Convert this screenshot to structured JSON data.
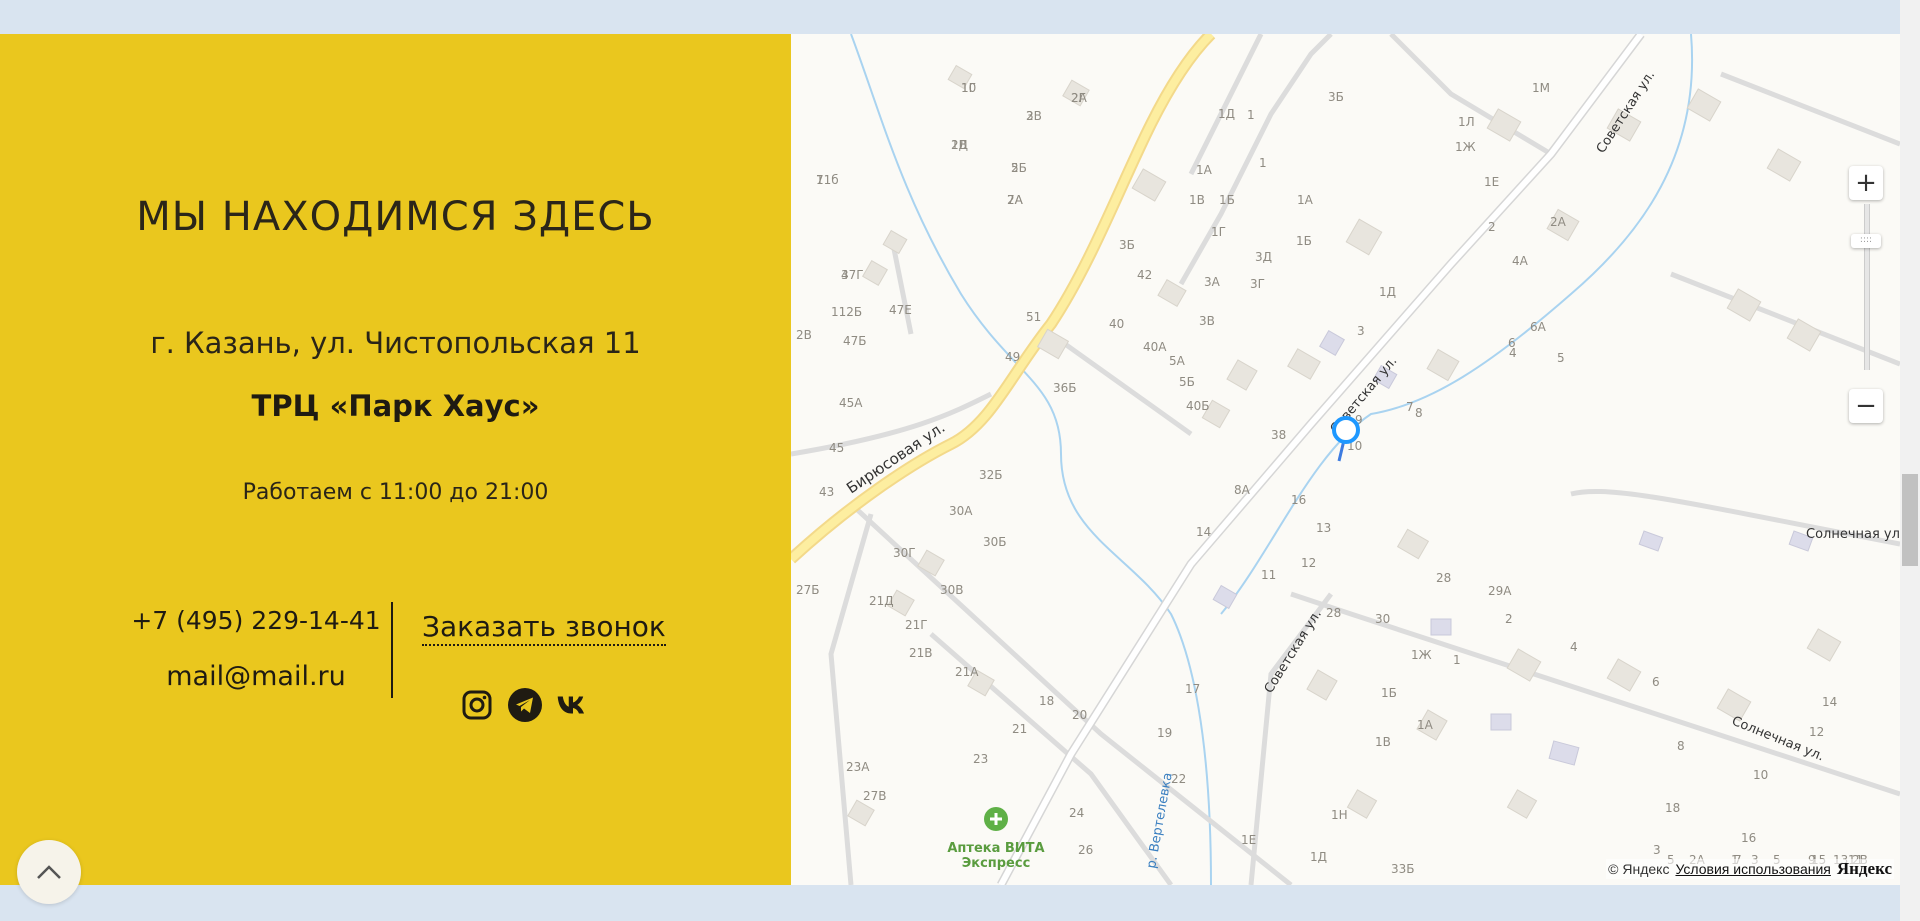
{
  "contact": {
    "title": "МЫ НАХОДИМСЯ ЗДЕСЬ",
    "address": "г. Казань, ул. Чистопольская 11",
    "venue": "ТРЦ «Парк Хаус»",
    "hours": "Работаем с 11:00 до 21:00",
    "phone": "+7 (495) 229-14-41",
    "email": "mail@mail.ru",
    "callback_label": "Заказать звонок",
    "socials": [
      "instagram-icon",
      "telegram-icon",
      "vk-icon"
    ]
  },
  "map": {
    "streets": {
      "birusovaya": "Бирюсовая ул.",
      "sovetskaya_1": "Советская ул.",
      "sovetskaya_2": "Советская ул.",
      "sovetskaya_3": "Советская ул.",
      "solnechnaya_1": "Солнечная ул.",
      "solnechnaya_2": "Солнечная ул.",
      "river": "р. Вертелевка"
    },
    "poi": {
      "name_line1": "Аптека ВИТА",
      "name_line2": "Экспресс"
    },
    "house_numbers": [
      "1Г",
      "2Г",
      "1Д",
      "2В",
      "2Б",
      "2А",
      "11б",
      "47Г",
      "112Б",
      "47Е",
      "2В",
      "47Б",
      "51",
      "45А",
      "49",
      "45",
      "43",
      "1А",
      "1В",
      "1Б",
      "1Г",
      "1Д",
      "1",
      "3Б",
      "1М",
      "1Л",
      "1Ж",
      "1Е",
      "1",
      "2",
      "2А",
      "4А",
      "4",
      "5",
      "6",
      "6А",
      "3",
      "1Д",
      "1А",
      "1Б",
      "3Б",
      "3Д",
      "3Г",
      "3А",
      "42",
      "3В",
      "40",
      "40А",
      "5А",
      "5Б",
      "40Б",
      "36Б",
      "32Б",
      "30А",
      "30Б",
      "30Г",
      "30В",
      "21Д",
      "21Г",
      "21В",
      "21А",
      "21",
      "23",
      "23А",
      "27В",
      "27Б",
      "38",
      "7",
      "8",
      "8А",
      "9",
      "10",
      "12",
      "13",
      "14",
      "16",
      "11",
      "18",
      "20",
      "17",
      "19",
      "22",
      "24",
      "26",
      "28",
      "30",
      "1Ж",
      "1",
      "1Б",
      "1А",
      "1В",
      "1Н",
      "1Д",
      "1Е",
      "33Б",
      "28",
      "29А",
      "2",
      "4",
      "6",
      "8",
      "10",
      "12",
      "14",
      "16",
      "18",
      "3",
      "5",
      "7",
      "9",
      "11",
      "13",
      "15",
      "1",
      "3",
      "5",
      "2В",
      "2А",
      "10",
      "2А",
      "2В",
      "3",
      "5",
      "7А",
      "7",
      "3"
    ],
    "controls": {
      "zoom_in": "+",
      "zoom_out": "−",
      "handle": "::::"
    },
    "copyright": "© Яндекс",
    "terms_link": "Условия использования",
    "logo": "Яндекс"
  },
  "colors": {
    "panel": "#eac71e",
    "page_bg": "#d9e4f0",
    "map_bg": "#fbfaf6",
    "road_major": "#fdeea0",
    "pin": "#1e98ff"
  }
}
